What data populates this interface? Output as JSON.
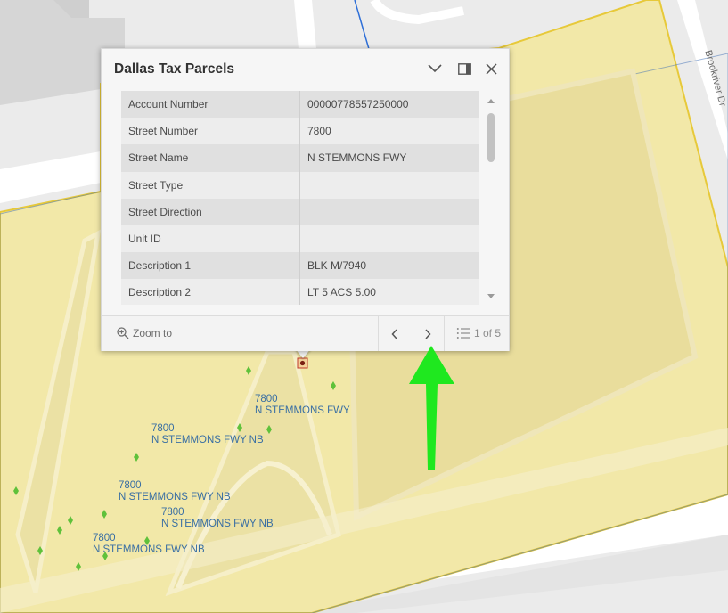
{
  "popup": {
    "title": "Dallas Tax Parcels",
    "attributes": [
      {
        "field": "Account Number",
        "value": "00000778557250000"
      },
      {
        "field": "Street Number",
        "value": "7800"
      },
      {
        "field": "Street Name",
        "value": "N STEMMONS FWY"
      },
      {
        "field": "Street Type",
        "value": ""
      },
      {
        "field": "Street Direction",
        "value": ""
      },
      {
        "field": "Unit ID",
        "value": ""
      },
      {
        "field": "Description 1",
        "value": "BLK M/7940"
      },
      {
        "field": "Description 2",
        "value": "LT 5 ACS 5.00"
      }
    ],
    "footer": {
      "zoom_label": "Zoom to",
      "feature_count": "1 of 5"
    }
  },
  "map": {
    "road_label": "Brookriver Dr",
    "labels": [
      {
        "line1": "7800",
        "line2": "N STEMMONS FWY"
      },
      {
        "line1": "7800",
        "line2": "N STEMMONS FWY NB"
      },
      {
        "line1": "7800",
        "line2": "N STEMMONS FWY NB"
      },
      {
        "line1": "7800",
        "line2": "N STEMMONS FWY NB"
      },
      {
        "line1": "7800",
        "line2": "N STEMMONS FWY NB"
      }
    ],
    "colors": {
      "parcel_fill": "#f2e8a8",
      "parcel_outline": "#e7c93a",
      "road": "#ffffff",
      "building": "#d9d9d9",
      "point_marker": "#5fc13a",
      "label_text": "#3a6fa3",
      "annotation_arrow": "#1fe81f"
    }
  }
}
